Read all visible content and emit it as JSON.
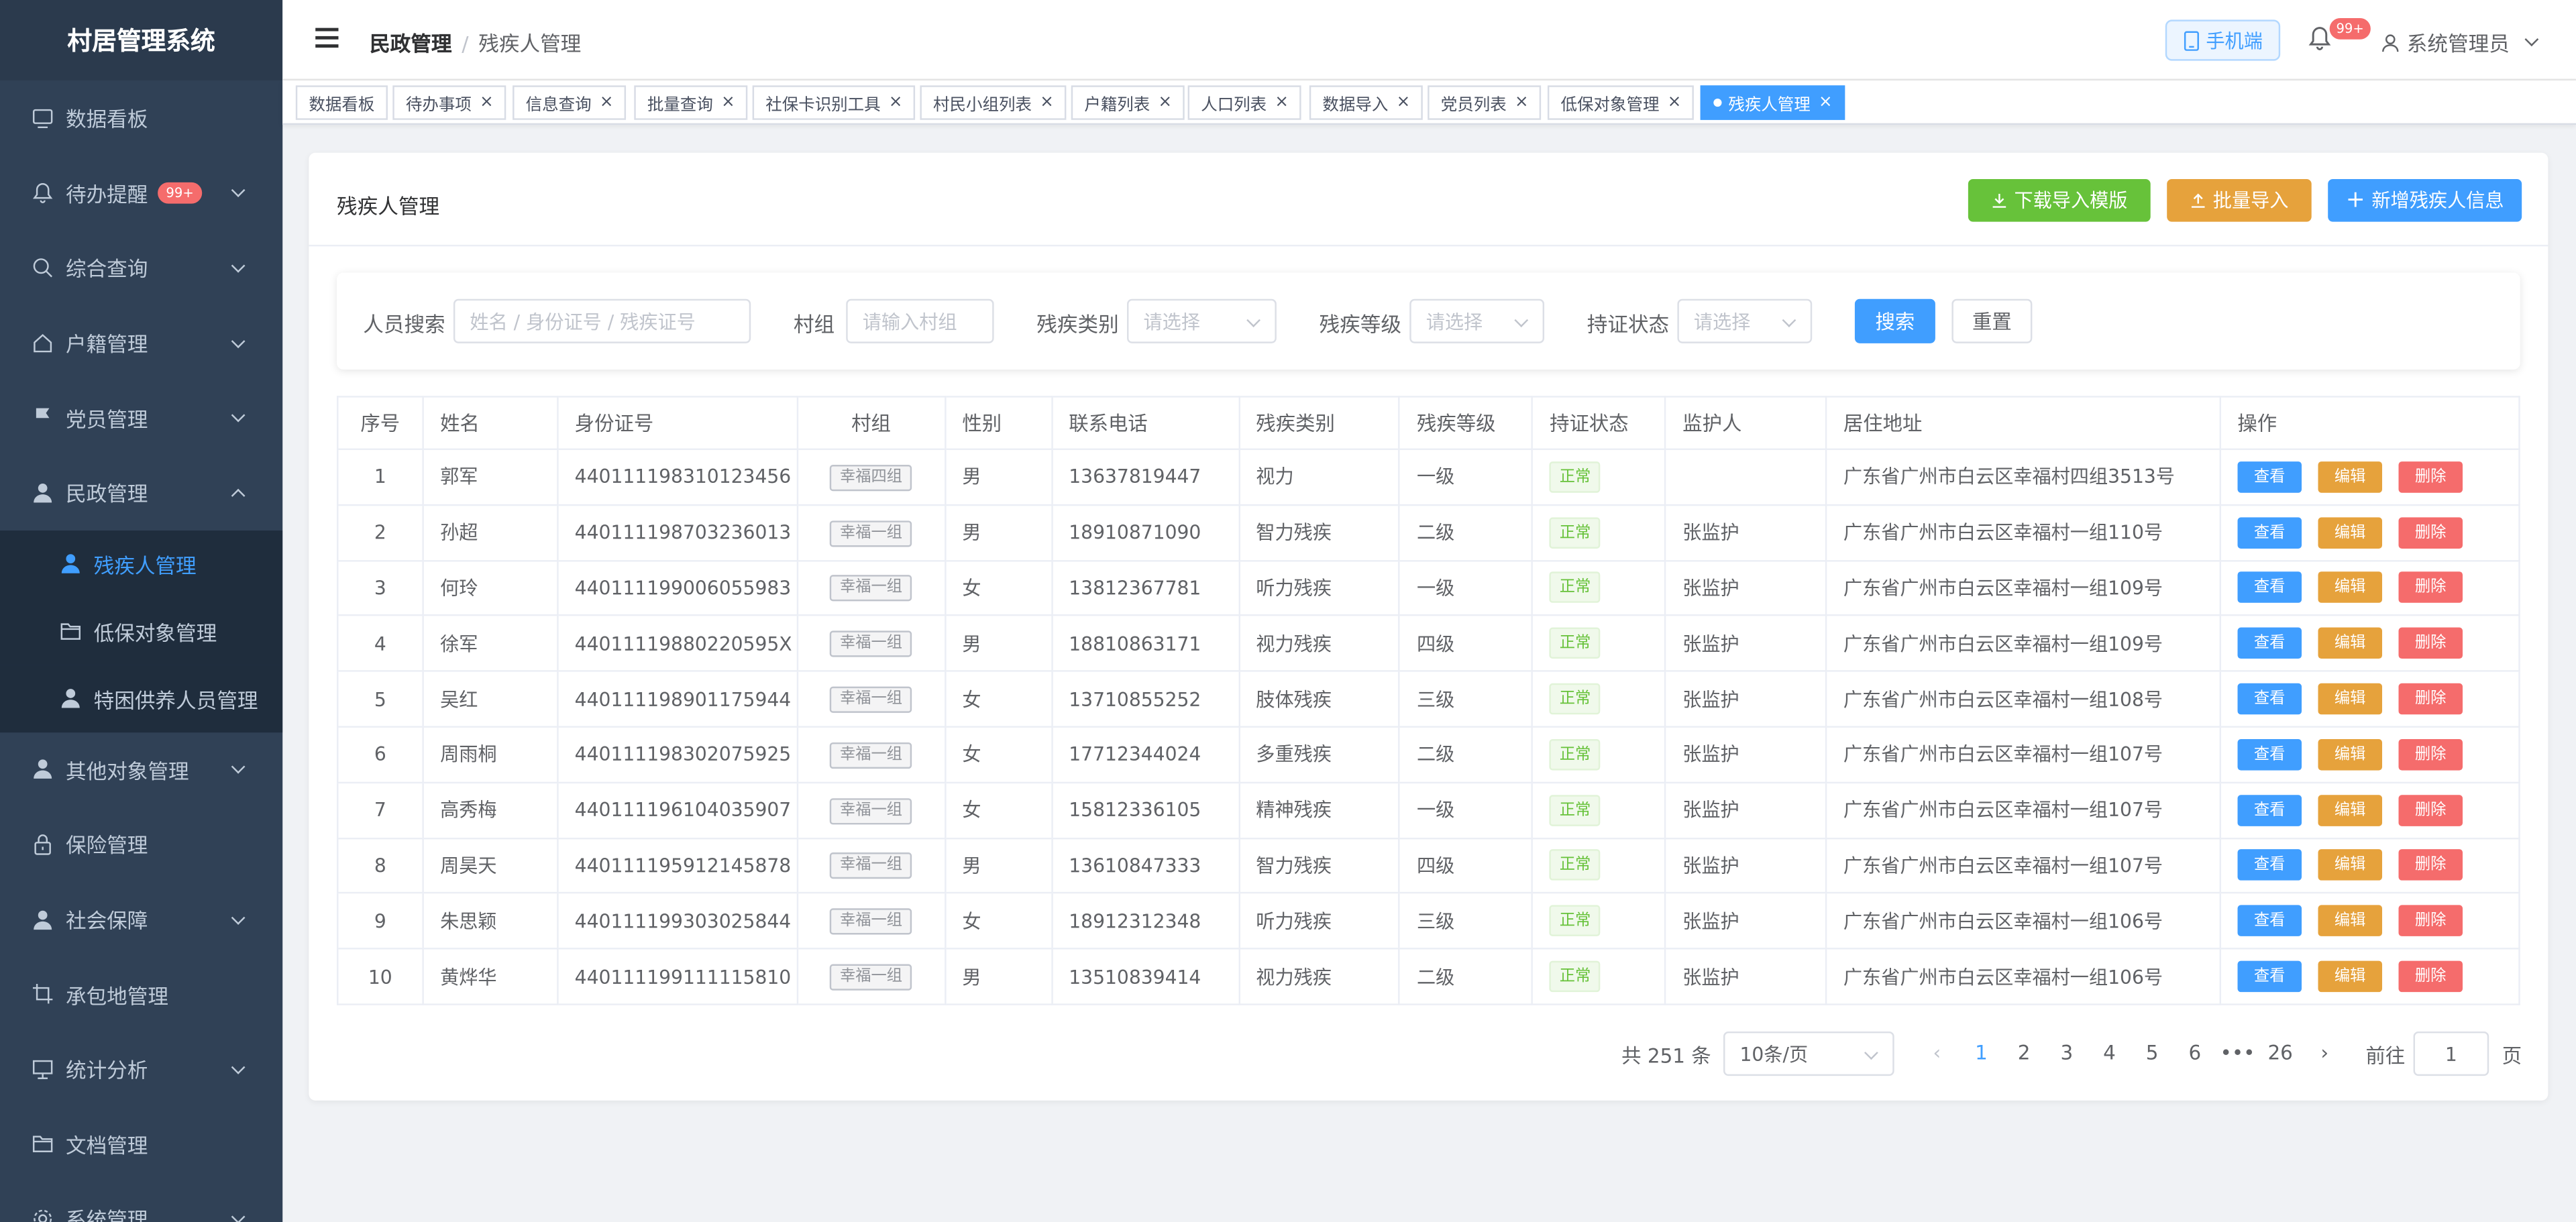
{
  "app_title": "村居管理系统",
  "sidebar": {
    "items": [
      {
        "label": "数据看板",
        "icon": "monitor-icon",
        "arrow": false
      },
      {
        "label": "待办提醒",
        "icon": "bell-icon",
        "arrow": true,
        "badge": "99+"
      },
      {
        "label": "综合查询",
        "icon": "search-icon",
        "arrow": true
      },
      {
        "label": "户籍管理",
        "icon": "home-icon",
        "arrow": true
      },
      {
        "label": "党员管理",
        "icon": "flag-icon",
        "arrow": true
      },
      {
        "label": "民政管理",
        "icon": "user-icon",
        "arrow": true,
        "expanded": true
      },
      {
        "label": "残疾人管理",
        "icon": "user-icon",
        "sub": true,
        "active": true
      },
      {
        "label": "低保对象管理",
        "icon": "folder-icon",
        "sub": true
      },
      {
        "label": "特困供养人员管理",
        "icon": "user-icon",
        "sub": true
      },
      {
        "label": "其他对象管理",
        "icon": "user-icon",
        "arrow": true
      },
      {
        "label": "保险管理",
        "icon": "lock-icon",
        "arrow": false
      },
      {
        "label": "社会保障",
        "icon": "user-icon",
        "arrow": true
      },
      {
        "label": "承包地管理",
        "icon": "crop-icon",
        "arrow": false
      },
      {
        "label": "统计分析",
        "icon": "chart-icon",
        "arrow": true
      },
      {
        "label": "文档管理",
        "icon": "folder-icon",
        "arrow": false
      },
      {
        "label": "系统管理",
        "icon": "gear-icon",
        "arrow": true
      }
    ]
  },
  "header": {
    "breadcrumb": [
      "民政管理",
      "残疾人管理"
    ],
    "mobile_label": "手机端",
    "bell_badge": "99+",
    "user": "系统管理员"
  },
  "tags": [
    "数据看板",
    "待办事项",
    "信息查询",
    "批量查询",
    "社保卡识别工具",
    "村民小组列表",
    "户籍列表",
    "人口列表",
    "数据导入",
    "党员列表",
    "低保对象管理",
    "残疾人管理"
  ],
  "card": {
    "title": "残疾人管理",
    "btn_download": "下载导入模版",
    "btn_import": "批量导入",
    "btn_add": "新增残疾人信息"
  },
  "filter": {
    "person_label": "人员搜索",
    "person_placeholder": "姓名 / 身份证号 / 残疾证号",
    "group_label": "村组",
    "group_placeholder": "请输入村组",
    "type_label": "残疾类别",
    "type_placeholder": "请选择",
    "level_label": "残疾等级",
    "level_placeholder": "请选择",
    "cert_label": "持证状态",
    "cert_placeholder": "请选择",
    "search_btn": "搜索",
    "reset_btn": "重置"
  },
  "table": {
    "headers": [
      "序号",
      "姓名",
      "身份证号",
      "村组",
      "性别",
      "联系电话",
      "残疾类别",
      "残疾等级",
      "持证状态",
      "监护人",
      "居住地址",
      "操作"
    ],
    "actions": {
      "view": "查看",
      "edit": "编辑",
      "delete": "删除"
    },
    "rows": [
      [
        "1",
        "郭军",
        "440111198310123456",
        "幸福四组",
        "男",
        "13637819447",
        "视力",
        "一级",
        "正常",
        "",
        "广东省广州市白云区幸福村四组3513号"
      ],
      [
        "2",
        "孙超",
        "440111198703236013",
        "幸福一组",
        "男",
        "18910871090",
        "智力残疾",
        "二级",
        "正常",
        "张监护",
        "广东省广州市白云区幸福村一组110号"
      ],
      [
        "3",
        "何玲",
        "440111199006055983",
        "幸福一组",
        "女",
        "13812367781",
        "听力残疾",
        "一级",
        "正常",
        "张监护",
        "广东省广州市白云区幸福村一组109号"
      ],
      [
        "4",
        "徐军",
        "44011119880220595X",
        "幸福一组",
        "男",
        "18810863171",
        "视力残疾",
        "四级",
        "正常",
        "张监护",
        "广东省广州市白云区幸福村一组109号"
      ],
      [
        "5",
        "吴红",
        "440111198901175944",
        "幸福一组",
        "女",
        "13710855252",
        "肢体残疾",
        "三级",
        "正常",
        "张监护",
        "广东省广州市白云区幸福村一组108号"
      ],
      [
        "6",
        "周雨桐",
        "440111198302075925",
        "幸福一组",
        "女",
        "17712344024",
        "多重残疾",
        "二级",
        "正常",
        "张监护",
        "广东省广州市白云区幸福村一组107号"
      ],
      [
        "7",
        "高秀梅",
        "440111196104035907",
        "幸福一组",
        "女",
        "15812336105",
        "精神残疾",
        "一级",
        "正常",
        "张监护",
        "广东省广州市白云区幸福村一组107号"
      ],
      [
        "8",
        "周昊天",
        "440111195912145878",
        "幸福一组",
        "男",
        "13610847333",
        "智力残疾",
        "四级",
        "正常",
        "张监护",
        "广东省广州市白云区幸福村一组107号"
      ],
      [
        "9",
        "朱思颖",
        "440111199303025844",
        "幸福一组",
        "女",
        "18912312348",
        "听力残疾",
        "三级",
        "正常",
        "张监护",
        "广东省广州市白云区幸福村一组106号"
      ],
      [
        "10",
        "黄烨华",
        "440111199111115810",
        "幸福一组",
        "男",
        "13510839414",
        "视力残疾",
        "二级",
        "正常",
        "张监护",
        "广东省广州市白云区幸福村一组106号"
      ]
    ]
  },
  "pagination": {
    "total": "共 251 条",
    "page_size": "10条/页",
    "pages": [
      "1",
      "2",
      "3",
      "4",
      "5",
      "6",
      "•••",
      "26"
    ],
    "current": "1",
    "goto_label": "前往",
    "goto_value": "1",
    "page_unit": "页"
  },
  "colors": {
    "sidebar_bg": "#304156",
    "accent": "#409eff",
    "success": "#67c23a",
    "warning": "#e6a23c",
    "danger": "#f56c6c"
  }
}
